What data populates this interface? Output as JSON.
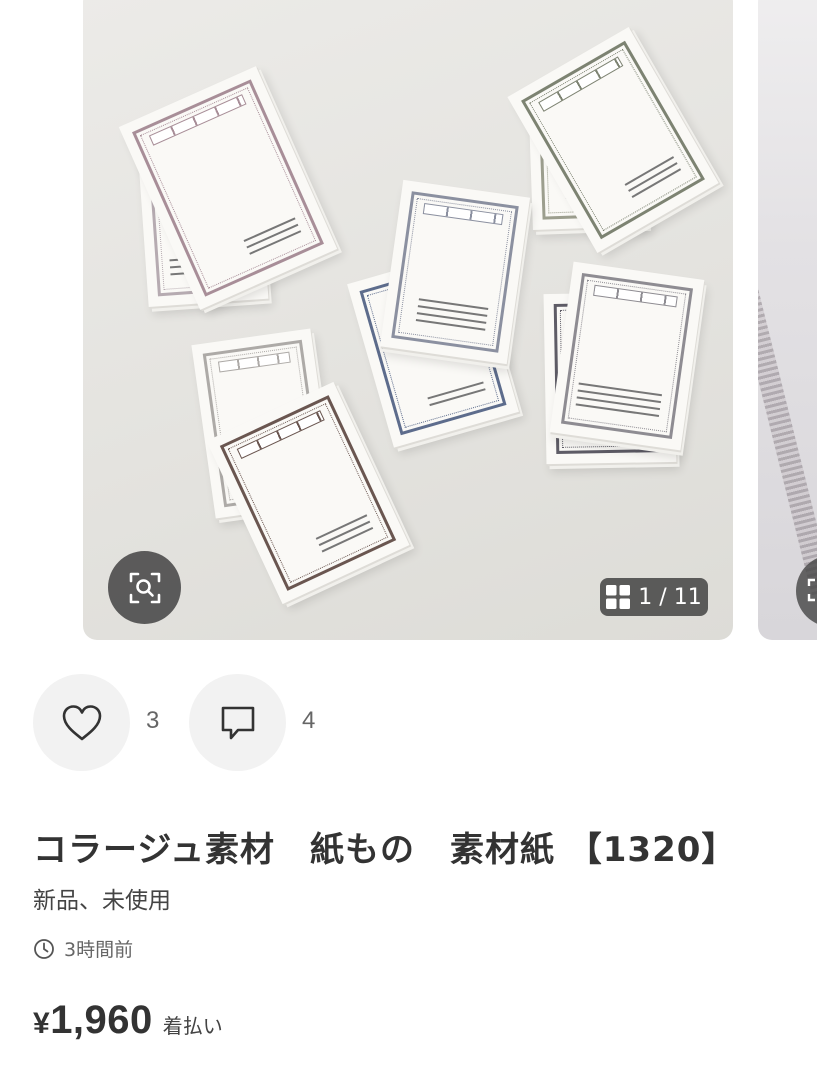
{
  "gallery": {
    "current_page": "1",
    "separator": "/",
    "total_pages": "11",
    "zoom_icon": "zoom-scan-icon",
    "grid_icon": "grid-icon"
  },
  "actions": {
    "like_icon": "heart-icon",
    "like_count": "3",
    "comment_icon": "comment-icon",
    "comment_count": "4"
  },
  "item": {
    "title": "コラージュ素材　紙もの　素材紙 【1320】",
    "condition": "新品、未使用",
    "posted_time": "3時間前",
    "time_icon": "clock-icon",
    "currency_symbol": "¥",
    "price": "1,960",
    "shipping_label": "着払い"
  },
  "colors": {
    "overlay_background": "#404040",
    "action_background": "#f2f2f2",
    "text_primary": "#333333",
    "text_secondary": "#666666"
  }
}
